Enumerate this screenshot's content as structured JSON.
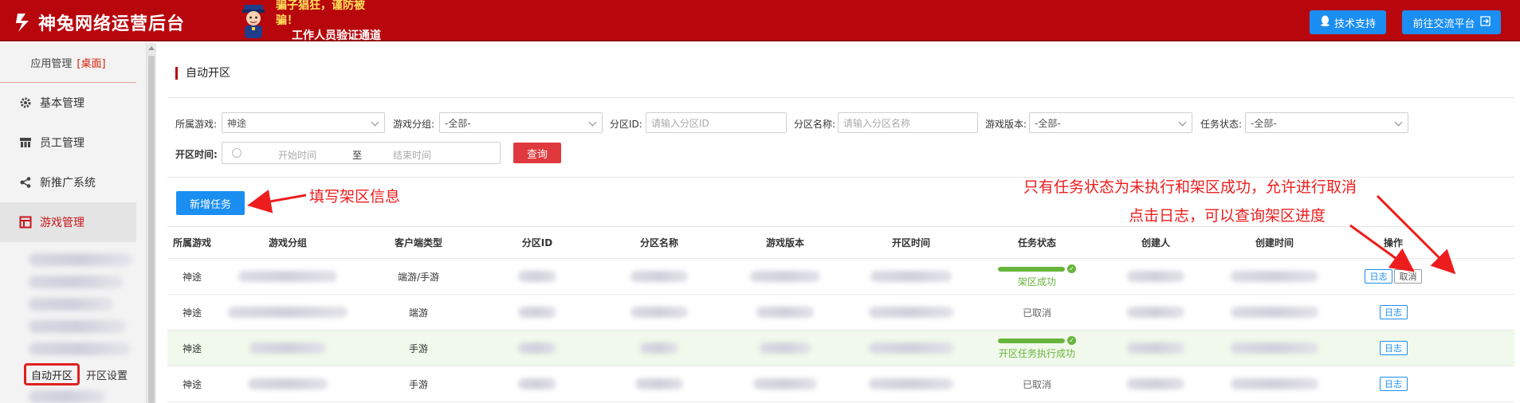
{
  "header": {
    "brand_name": "神兔网络运营后台",
    "notice_line1": "骗子猖狂，谨防被骗！",
    "notice_line2": "工作人员验证通道",
    "support_button": "技术支持",
    "platform_button": "前往交流平台"
  },
  "sidebar": {
    "app_management": "应用管理",
    "desktop_tag": "[桌面]",
    "items": [
      {
        "label": "基本管理",
        "icon": "gear-icon"
      },
      {
        "label": "员工管理",
        "icon": "org-icon"
      },
      {
        "label": "新推广系统",
        "icon": "share-icon"
      },
      {
        "label": "游戏管理",
        "icon": "layout-icon"
      }
    ],
    "sub_auto": "自动开区",
    "sub_settings": "开区设置"
  },
  "page": {
    "title": "自动开区"
  },
  "filters": {
    "game_label": "所属游戏:",
    "game_value": "神途",
    "group_label": "游戏分组:",
    "group_value": "-全部-",
    "zone_id_label": "分区ID:",
    "zone_id_placeholder": "请输入分区ID",
    "zone_name_label": "分区名称:",
    "zone_name_placeholder": "请输入分区名称",
    "version_label": "游戏版本:",
    "version_value": "-全部-",
    "status_label": "任务状态:",
    "status_value": "-全部-",
    "time_label": "开区时间:",
    "start_placeholder": "开始时间",
    "to_text": "至",
    "end_placeholder": "结束时间",
    "query_button": "查询"
  },
  "toolbar": {
    "new_task": "新增任务"
  },
  "annotations": {
    "fill_info": "填写架区信息",
    "cancel_rule": "只有任务状态为未执行和架区成功，允许进行取消",
    "log_rule": "点击日志，可以查询架区进度"
  },
  "table": {
    "headers": [
      "所属游戏",
      "游戏分组",
      "客户端类型",
      "分区ID",
      "分区名称",
      "游戏版本",
      "开区时间",
      "任务状态",
      "创建人",
      "创建时间",
      "操作"
    ],
    "rows": [
      {
        "game": "神途",
        "client": "端游/手游",
        "status_text": "架区成功",
        "status_kind": "success",
        "progress": 1.0,
        "actions": [
          "日志",
          "取消"
        ]
      },
      {
        "game": "神途",
        "client": "端游",
        "status_text": "已取消",
        "status_kind": "cancel",
        "progress": 0,
        "actions": [
          "日志"
        ]
      },
      {
        "game": "神途",
        "client": "手游",
        "status_text": "开区任务执行成功",
        "status_kind": "success",
        "progress": 1.0,
        "actions": [
          "日志"
        ]
      },
      {
        "game": "神途",
        "client": "手游",
        "status_text": "已取消",
        "status_kind": "cancel",
        "progress": 0,
        "actions": [
          "日志"
        ]
      }
    ]
  },
  "colors": {
    "header_red": "#b8070c",
    "primary_blue": "#1b8ef2",
    "success_green": "#67b53b",
    "annotation_red": "#ee1d1d"
  }
}
